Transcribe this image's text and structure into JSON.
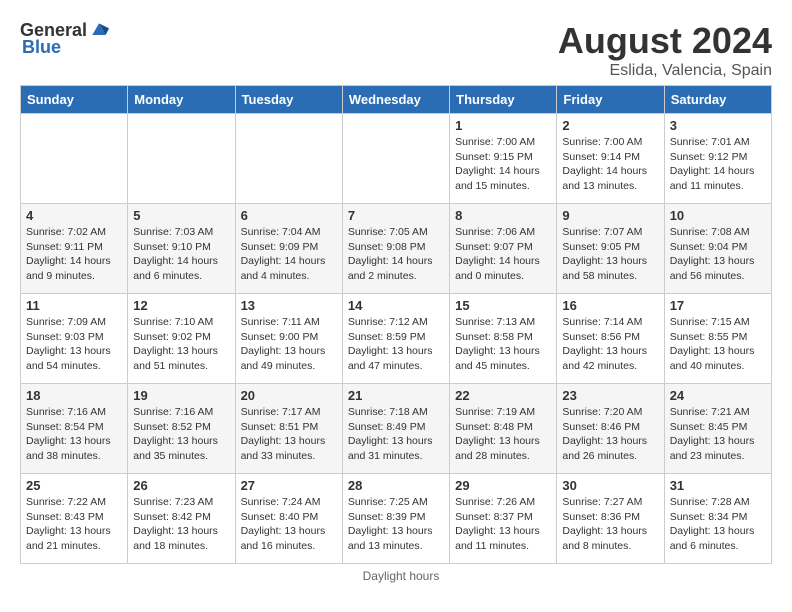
{
  "header": {
    "logo_general": "General",
    "logo_blue": "Blue",
    "title": "August 2024",
    "subtitle": "Eslida, Valencia, Spain"
  },
  "days_of_week": [
    "Sunday",
    "Monday",
    "Tuesday",
    "Wednesday",
    "Thursday",
    "Friday",
    "Saturday"
  ],
  "weeks": [
    [
      {
        "day": "",
        "info": ""
      },
      {
        "day": "",
        "info": ""
      },
      {
        "day": "",
        "info": ""
      },
      {
        "day": "",
        "info": ""
      },
      {
        "day": "1",
        "info": "Sunrise: 7:00 AM\nSunset: 9:15 PM\nDaylight: 14 hours\nand 15 minutes."
      },
      {
        "day": "2",
        "info": "Sunrise: 7:00 AM\nSunset: 9:14 PM\nDaylight: 14 hours\nand 13 minutes."
      },
      {
        "day": "3",
        "info": "Sunrise: 7:01 AM\nSunset: 9:12 PM\nDaylight: 14 hours\nand 11 minutes."
      }
    ],
    [
      {
        "day": "4",
        "info": "Sunrise: 7:02 AM\nSunset: 9:11 PM\nDaylight: 14 hours\nand 9 minutes."
      },
      {
        "day": "5",
        "info": "Sunrise: 7:03 AM\nSunset: 9:10 PM\nDaylight: 14 hours\nand 6 minutes."
      },
      {
        "day": "6",
        "info": "Sunrise: 7:04 AM\nSunset: 9:09 PM\nDaylight: 14 hours\nand 4 minutes."
      },
      {
        "day": "7",
        "info": "Sunrise: 7:05 AM\nSunset: 9:08 PM\nDaylight: 14 hours\nand 2 minutes."
      },
      {
        "day": "8",
        "info": "Sunrise: 7:06 AM\nSunset: 9:07 PM\nDaylight: 14 hours\nand 0 minutes."
      },
      {
        "day": "9",
        "info": "Sunrise: 7:07 AM\nSunset: 9:05 PM\nDaylight: 13 hours\nand 58 minutes."
      },
      {
        "day": "10",
        "info": "Sunrise: 7:08 AM\nSunset: 9:04 PM\nDaylight: 13 hours\nand 56 minutes."
      }
    ],
    [
      {
        "day": "11",
        "info": "Sunrise: 7:09 AM\nSunset: 9:03 PM\nDaylight: 13 hours\nand 54 minutes."
      },
      {
        "day": "12",
        "info": "Sunrise: 7:10 AM\nSunset: 9:02 PM\nDaylight: 13 hours\nand 51 minutes."
      },
      {
        "day": "13",
        "info": "Sunrise: 7:11 AM\nSunset: 9:00 PM\nDaylight: 13 hours\nand 49 minutes."
      },
      {
        "day": "14",
        "info": "Sunrise: 7:12 AM\nSunset: 8:59 PM\nDaylight: 13 hours\nand 47 minutes."
      },
      {
        "day": "15",
        "info": "Sunrise: 7:13 AM\nSunset: 8:58 PM\nDaylight: 13 hours\nand 45 minutes."
      },
      {
        "day": "16",
        "info": "Sunrise: 7:14 AM\nSunset: 8:56 PM\nDaylight: 13 hours\nand 42 minutes."
      },
      {
        "day": "17",
        "info": "Sunrise: 7:15 AM\nSunset: 8:55 PM\nDaylight: 13 hours\nand 40 minutes."
      }
    ],
    [
      {
        "day": "18",
        "info": "Sunrise: 7:16 AM\nSunset: 8:54 PM\nDaylight: 13 hours\nand 38 minutes."
      },
      {
        "day": "19",
        "info": "Sunrise: 7:16 AM\nSunset: 8:52 PM\nDaylight: 13 hours\nand 35 minutes."
      },
      {
        "day": "20",
        "info": "Sunrise: 7:17 AM\nSunset: 8:51 PM\nDaylight: 13 hours\nand 33 minutes."
      },
      {
        "day": "21",
        "info": "Sunrise: 7:18 AM\nSunset: 8:49 PM\nDaylight: 13 hours\nand 31 minutes."
      },
      {
        "day": "22",
        "info": "Sunrise: 7:19 AM\nSunset: 8:48 PM\nDaylight: 13 hours\nand 28 minutes."
      },
      {
        "day": "23",
        "info": "Sunrise: 7:20 AM\nSunset: 8:46 PM\nDaylight: 13 hours\nand 26 minutes."
      },
      {
        "day": "24",
        "info": "Sunrise: 7:21 AM\nSunset: 8:45 PM\nDaylight: 13 hours\nand 23 minutes."
      }
    ],
    [
      {
        "day": "25",
        "info": "Sunrise: 7:22 AM\nSunset: 8:43 PM\nDaylight: 13 hours\nand 21 minutes."
      },
      {
        "day": "26",
        "info": "Sunrise: 7:23 AM\nSunset: 8:42 PM\nDaylight: 13 hours\nand 18 minutes."
      },
      {
        "day": "27",
        "info": "Sunrise: 7:24 AM\nSunset: 8:40 PM\nDaylight: 13 hours\nand 16 minutes."
      },
      {
        "day": "28",
        "info": "Sunrise: 7:25 AM\nSunset: 8:39 PM\nDaylight: 13 hours\nand 13 minutes."
      },
      {
        "day": "29",
        "info": "Sunrise: 7:26 AM\nSunset: 8:37 PM\nDaylight: 13 hours\nand 11 minutes."
      },
      {
        "day": "30",
        "info": "Sunrise: 7:27 AM\nSunset: 8:36 PM\nDaylight: 13 hours\nand 8 minutes."
      },
      {
        "day": "31",
        "info": "Sunrise: 7:28 AM\nSunset: 8:34 PM\nDaylight: 13 hours\nand 6 minutes."
      }
    ]
  ],
  "footer": {
    "label": "Daylight hours"
  }
}
